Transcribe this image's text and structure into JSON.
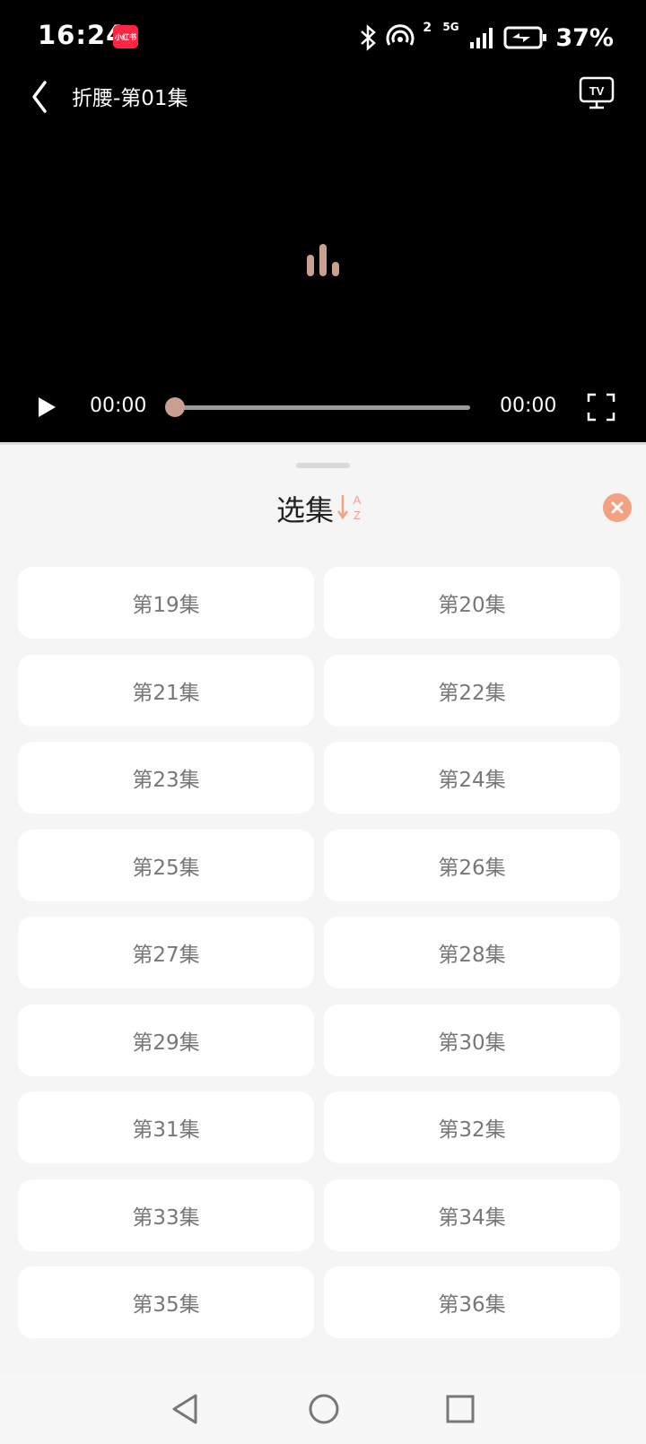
{
  "status_bar": {
    "time": "16:24",
    "app_badge": "小红书",
    "battery": "37%",
    "signal_label": "5G",
    "hotspot_count": "2"
  },
  "player": {
    "title": "折腰-第01集",
    "current_time": "00:00",
    "total_time": "00:00",
    "progress": 0,
    "tv_label": "TV"
  },
  "episode_sheet": {
    "title": "选集",
    "sort_label_top": "A",
    "sort_label_bottom": "Z",
    "episodes": [
      "第19集",
      "第20集",
      "第21集",
      "第22集",
      "第23集",
      "第24集",
      "第25集",
      "第26集",
      "第27集",
      "第28集",
      "第29集",
      "第30集",
      "第31集",
      "第32集",
      "第33集",
      "第34集",
      "第35集",
      "第36集"
    ]
  },
  "colors": {
    "accent": "#f2a182",
    "loading": "#c99f8f",
    "background": "#f5f5f5"
  }
}
